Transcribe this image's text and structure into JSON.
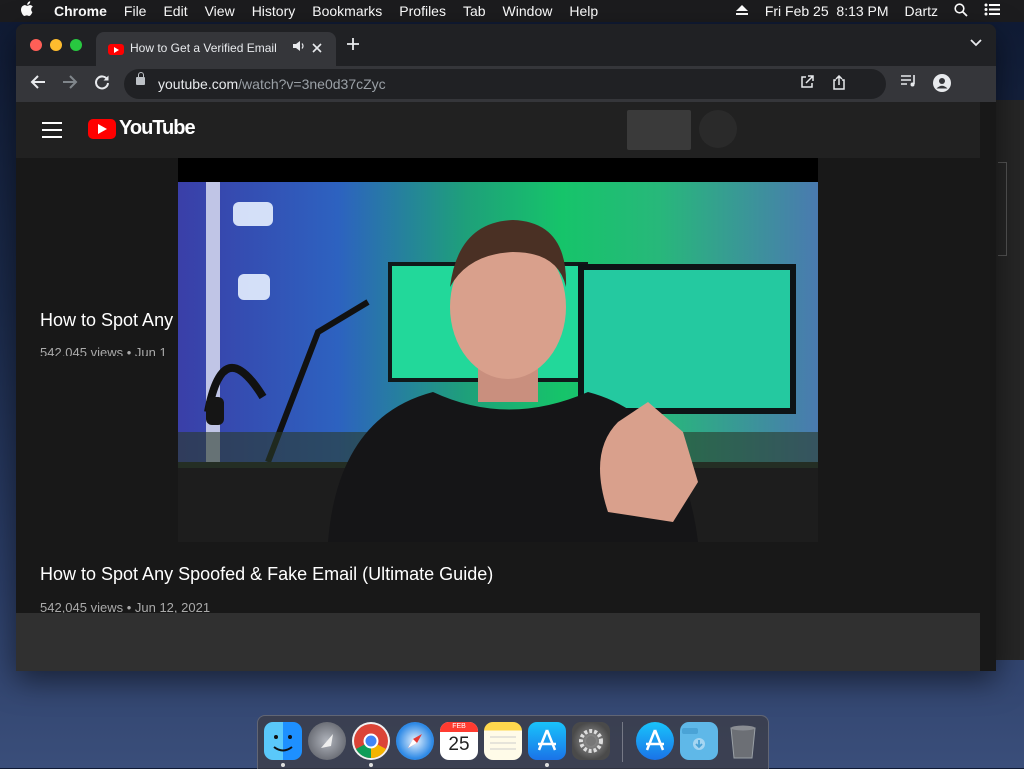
{
  "menubar": {
    "app": "Chrome",
    "items": [
      "File",
      "Edit",
      "View",
      "History",
      "Bookmarks",
      "Profiles",
      "Tab",
      "Window",
      "Help"
    ],
    "datetime": "Fri Feb 25  8:13 PM",
    "user": "Dartz"
  },
  "browser": {
    "tab_title": "How to Get a Verified Email",
    "url_host": "youtube.com",
    "url_path": "/watch?v=3ne0d37cZyc"
  },
  "youtube": {
    "logo_text": "YouTube",
    "video_title_top": "How to Spot Any",
    "video_meta_top": "542,045 views • Jun 1",
    "video_title": "How to Spot Any Spoofed & Fake Email (Ultimate Guide)",
    "video_meta": "542,045 views • Jun 12, 2021"
  },
  "dock": {
    "calendar_month": "FEB",
    "calendar_day": "25"
  },
  "colors": {
    "youtube_red": "#ff0000",
    "chrome_dark": "#202124",
    "toolbar": "#35363a"
  }
}
